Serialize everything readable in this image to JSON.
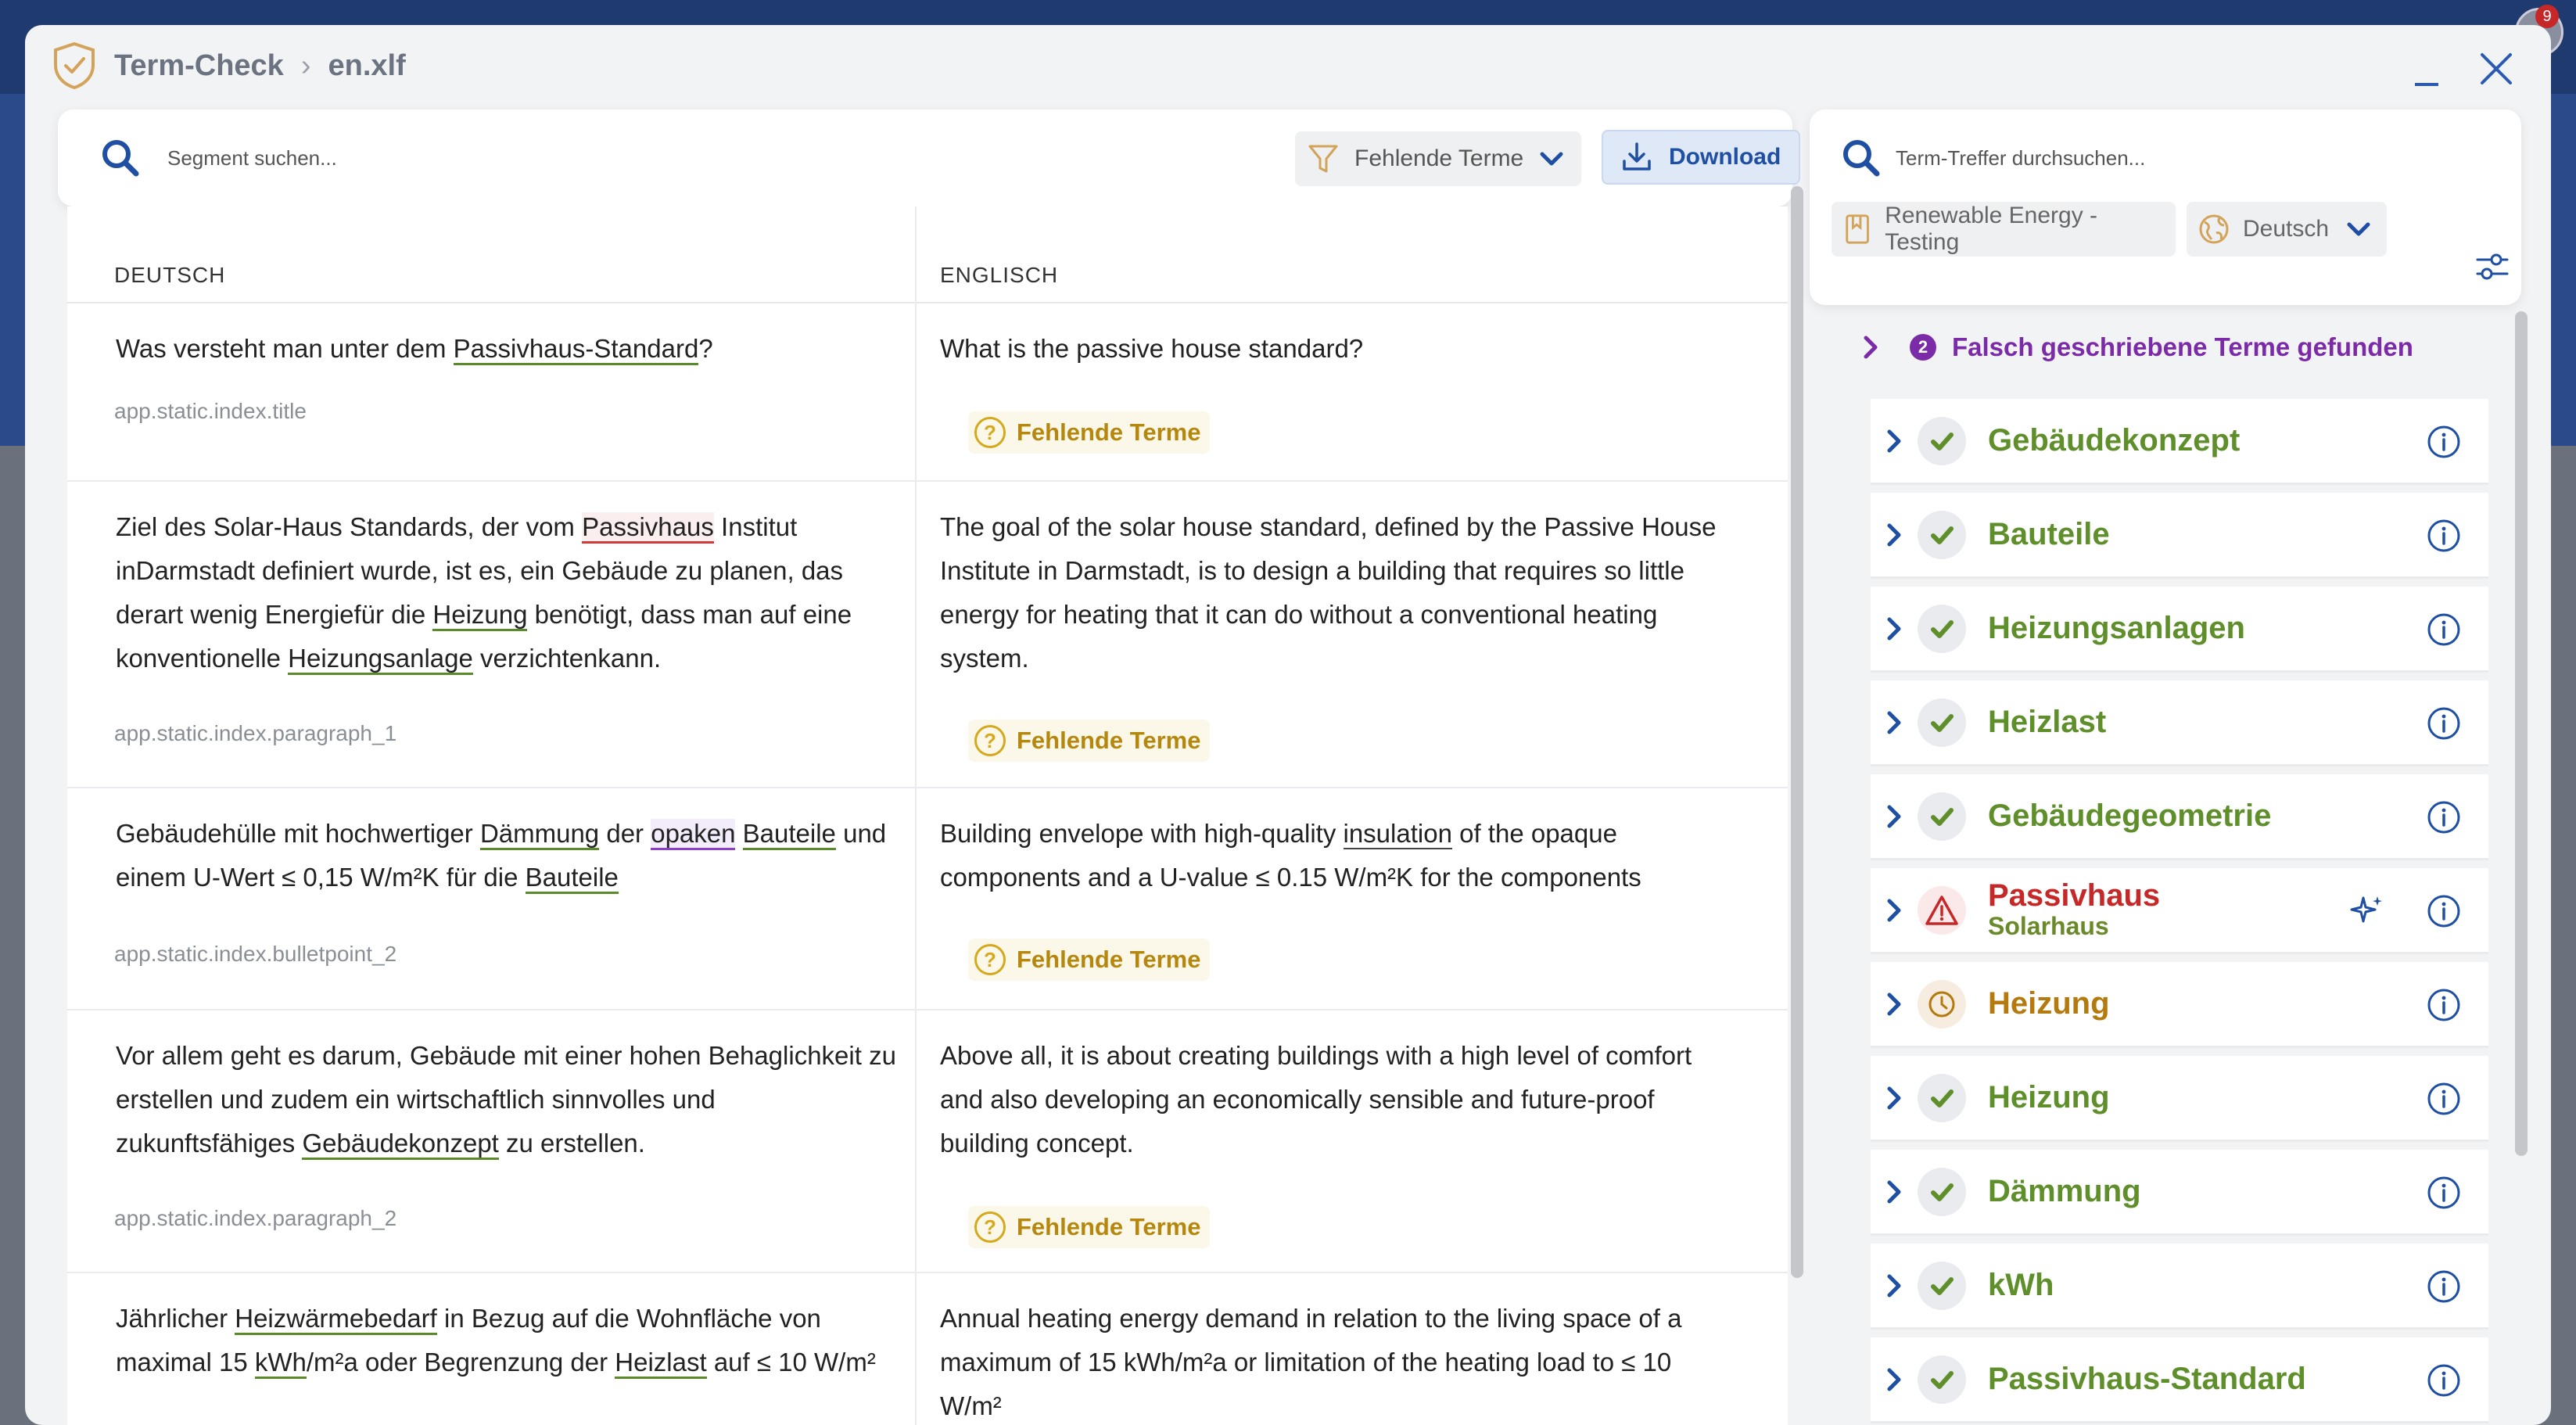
{
  "header": {
    "app_name": "Term-Check",
    "file_name": "en.xlf"
  },
  "left": {
    "search_placeholder": "Segment suchen...",
    "filter_label": "Fehlende Terme",
    "download_label": "Download",
    "columns": {
      "source": "DEUTSCH",
      "target": "ENGLISCH"
    },
    "missing_label": "Fehlende Terme"
  },
  "segments": [
    {
      "src_html": "Was versteht man unter dem <span class=\"u-green\">Passivhaus-Standard</span>?",
      "target": "What is the passive house standard?",
      "key": "app.static.index.title"
    },
    {
      "src_html": "Ziel des Solar-Haus Standards, der vom <span class=\"u-red\">Passivhaus</span> Institut inDarmstadt definiert wurde, ist es, ein Gebäude zu planen, das derart wenig Energiefür die <span class=\"u-green\">Heizung</span> benötigt, dass man auf eine konventionelle <span class=\"u-green\">Heizungsanlage</span> verzichtenkann.",
      "target": "The goal of the solar house standard, defined by the Passive House Institute in Darmstadt, is to design a building that requires so little energy for heating that it can do without a conventional heating system.",
      "key": "app.static.index.paragraph_1"
    },
    {
      "src_html": "Gebäudehülle mit hochwertiger <span class=\"u-green\">Dämmung</span> der <span class=\"u-purple\">opaken</span> <span class=\"u-green\">Bauteile</span> und einem U-Wert ≤ 0,15 W/m²K für die <span class=\"u-green\">Bauteile</span>",
      "target_html": "Building envelope with high-quality <span class=\"u-plain\">insulation</span> of the opaque components and a U-value ≤ 0.15 W/m²K for the components",
      "key": "app.static.index.bulletpoint_2"
    },
    {
      "src_html": "Vor allem geht es darum, Gebäude mit einer hohen Behaglichkeit zu erstellen und zudem ein wirtschaftlich sinnvolles und zukunftsfähiges <span class=\"u-green\">Gebäudekonzept</span> zu erstellen.",
      "target": "Above all, it is about creating buildings with a high level of comfort and also developing an economically sensible and future-proof building concept.",
      "key": "app.static.index.paragraph_2"
    },
    {
      "src_html": "Jährlicher <span class=\"u-green\">Heizwärmebedarf</span> in Bezug auf die Wohnfläche von maximal 15 <span class=\"u-green\">kWh</span>/m²a oder Begrenzung der <span class=\"u-green\">Heizlast</span> auf ≤ 10 W/m²",
      "target": "Annual heating energy demand in relation to the living space of a maximum of 15 kWh/m²a or limitation of the heating load to ≤ 10 W/m²"
    }
  ],
  "right": {
    "search_placeholder": "Term-Treffer durchsuchen...",
    "termbase": "Renewable Energy - Testing",
    "language": "Deutsch",
    "misspelled_count": "2",
    "misspelled_label": "Falsch geschriebene Terme gefunden",
    "terms": [
      {
        "name": "Gebäudekonzept",
        "status": "ok"
      },
      {
        "name": "Bauteile",
        "status": "ok"
      },
      {
        "name": "Heizungsanlagen",
        "status": "ok"
      },
      {
        "name": "Heizlast",
        "status": "ok"
      },
      {
        "name": "Gebäudegeometrie",
        "status": "ok"
      },
      {
        "name": "Passivhaus",
        "sub": "Solarhaus",
        "status": "error"
      },
      {
        "name": "Heizung",
        "status": "pending"
      },
      {
        "name": "Heizung",
        "status": "ok"
      },
      {
        "name": "Dämmung",
        "status": "ok"
      },
      {
        "name": "kWh",
        "status": "ok"
      },
      {
        "name": "Passivhaus-Standard",
        "status": "ok"
      }
    ]
  },
  "colors": {
    "ok": "#5e8f2a",
    "error": "#c62828",
    "pending": "#b57a0d",
    "accent": "#1f4fa3",
    "purple": "#7b2aa8"
  },
  "badge_count": "9"
}
